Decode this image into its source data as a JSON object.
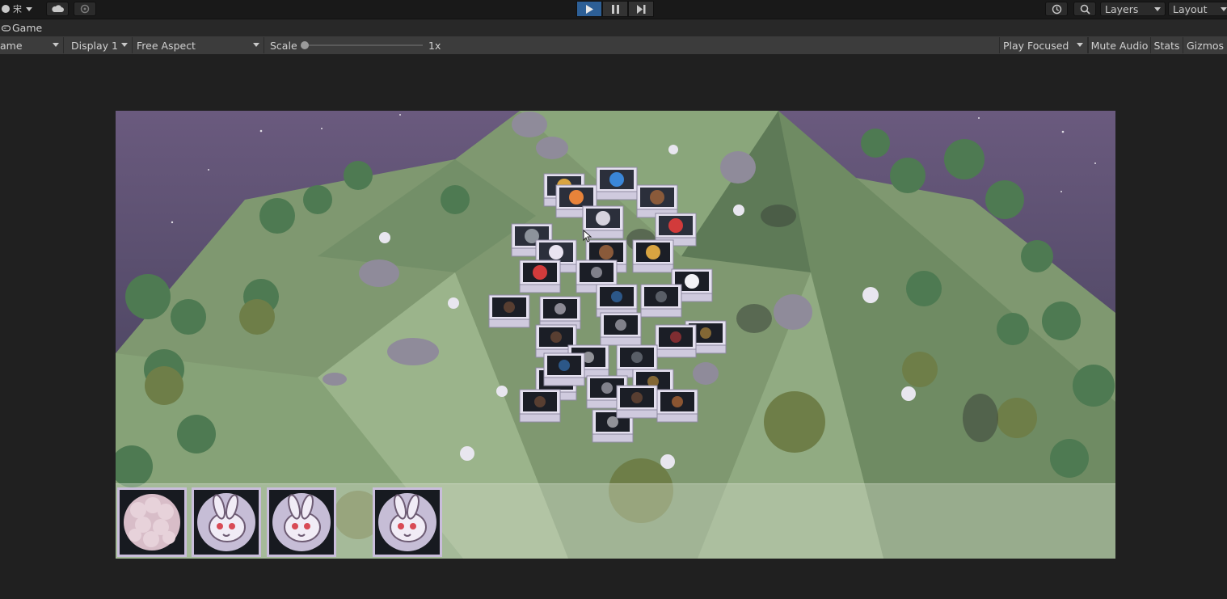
{
  "topbar": {
    "account_label": "宋",
    "cloud_icon": "cloud-icon",
    "collab_icon": "collab-icon",
    "history_icon": "history-icon",
    "search_icon": "search-icon",
    "layers_label": "Layers",
    "layout_label": "Layout"
  },
  "playbar": {
    "play_icon": "play-icon",
    "pause_icon": "pause-icon",
    "step_icon": "step-icon",
    "playing": true
  },
  "tab": {
    "icon": "gamepad-icon",
    "label": "Game"
  },
  "toolbar": {
    "view_dropdown": "ame",
    "display_dropdown": "Display 1",
    "aspect_dropdown": "Free Aspect",
    "scale_label": "Scale",
    "scale_value": "1x",
    "scale_fraction": 0.0,
    "play_mode_dropdown": "Play Focused",
    "mute_audio": "Mute Audio",
    "stats": "Stats",
    "gizmos": "Gizmos"
  },
  "game": {
    "tray_slots": [
      {
        "item": "wool-ball-icon"
      },
      {
        "item": "rabbit-icon"
      },
      {
        "item": "rabbit-icon"
      },
      {
        "item": "rabbit-icon"
      }
    ],
    "tile_icons": [
      "carrot-icon",
      "pruning-shears-icon",
      "hay-bale-icon",
      "log-icon",
      "pitchfork-icon",
      "water-bowl-icon",
      "rabbit-icon",
      "wool-ball-icon",
      "milk-jug-icon"
    ]
  },
  "colors": {
    "play_active": "#2d5f96",
    "sky": "#6a5a7e",
    "hill": "#7f9870",
    "tile_face": "#d9d5e8",
    "tray_border": "#c9bddb"
  }
}
